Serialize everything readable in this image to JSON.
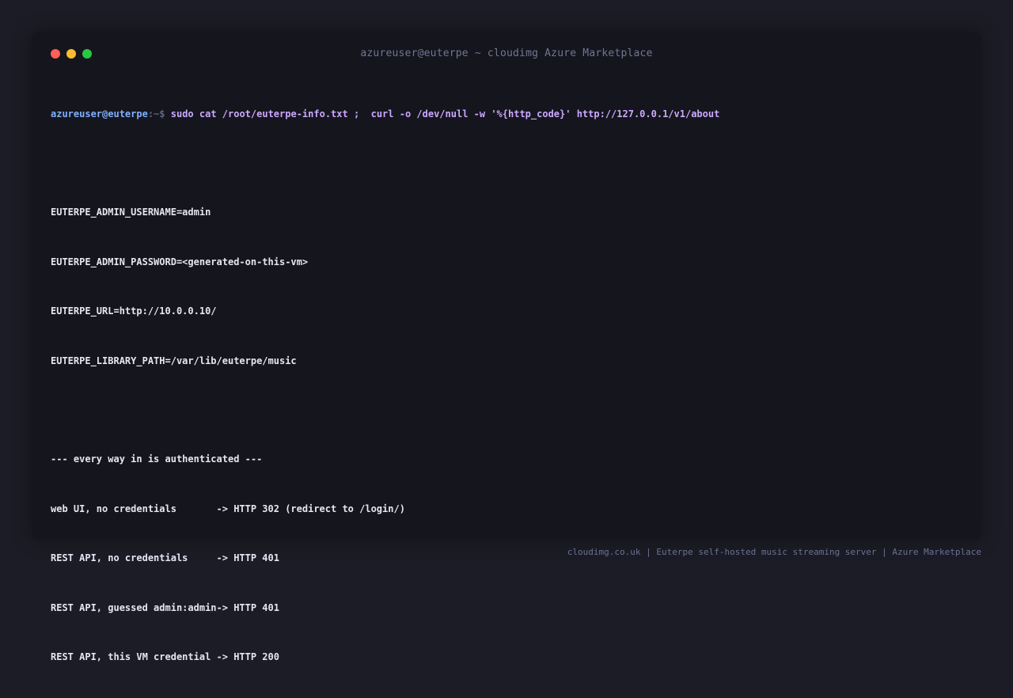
{
  "window": {
    "title": "azureuser@euterpe ~ cloudimg Azure Marketplace"
  },
  "terminal": {
    "prompt_user": "azureuser@euterpe",
    "prompt_sep": ":~$",
    "command": "sudo cat /root/euterpe-info.txt ;  curl -o /dev/null -w '%{http_code}' http://127.0.0.1/v1/about",
    "info_lines": [
      "EUTERPE_ADMIN_USERNAME=admin",
      "EUTERPE_ADMIN_PASSWORD=<generated-on-this-vm>",
      "EUTERPE_URL=http://10.0.0.10/",
      "EUTERPE_LIBRARY_PATH=/var/lib/euterpe/music"
    ],
    "auth_header": "--- every way in is authenticated ---",
    "auth_lines": [
      "web UI, no credentials       -> HTTP 302 (redirect to /login/)",
      "REST API, no credentials     -> HTTP 401",
      "REST API, guessed admin:admin-> HTTP 401",
      "REST API, this VM credential -> HTTP 200"
    ]
  },
  "footer": {
    "text": "cloudimg.co.uk | Euterpe self-hosted music streaming server | Azure Marketplace"
  },
  "colors": {
    "close": "#ff5f57",
    "minimize": "#febc2e",
    "maximize": "#28c840",
    "prompt_user": "#7fb0ff",
    "command": "#caa8ff",
    "output": "#e4e6f1"
  }
}
